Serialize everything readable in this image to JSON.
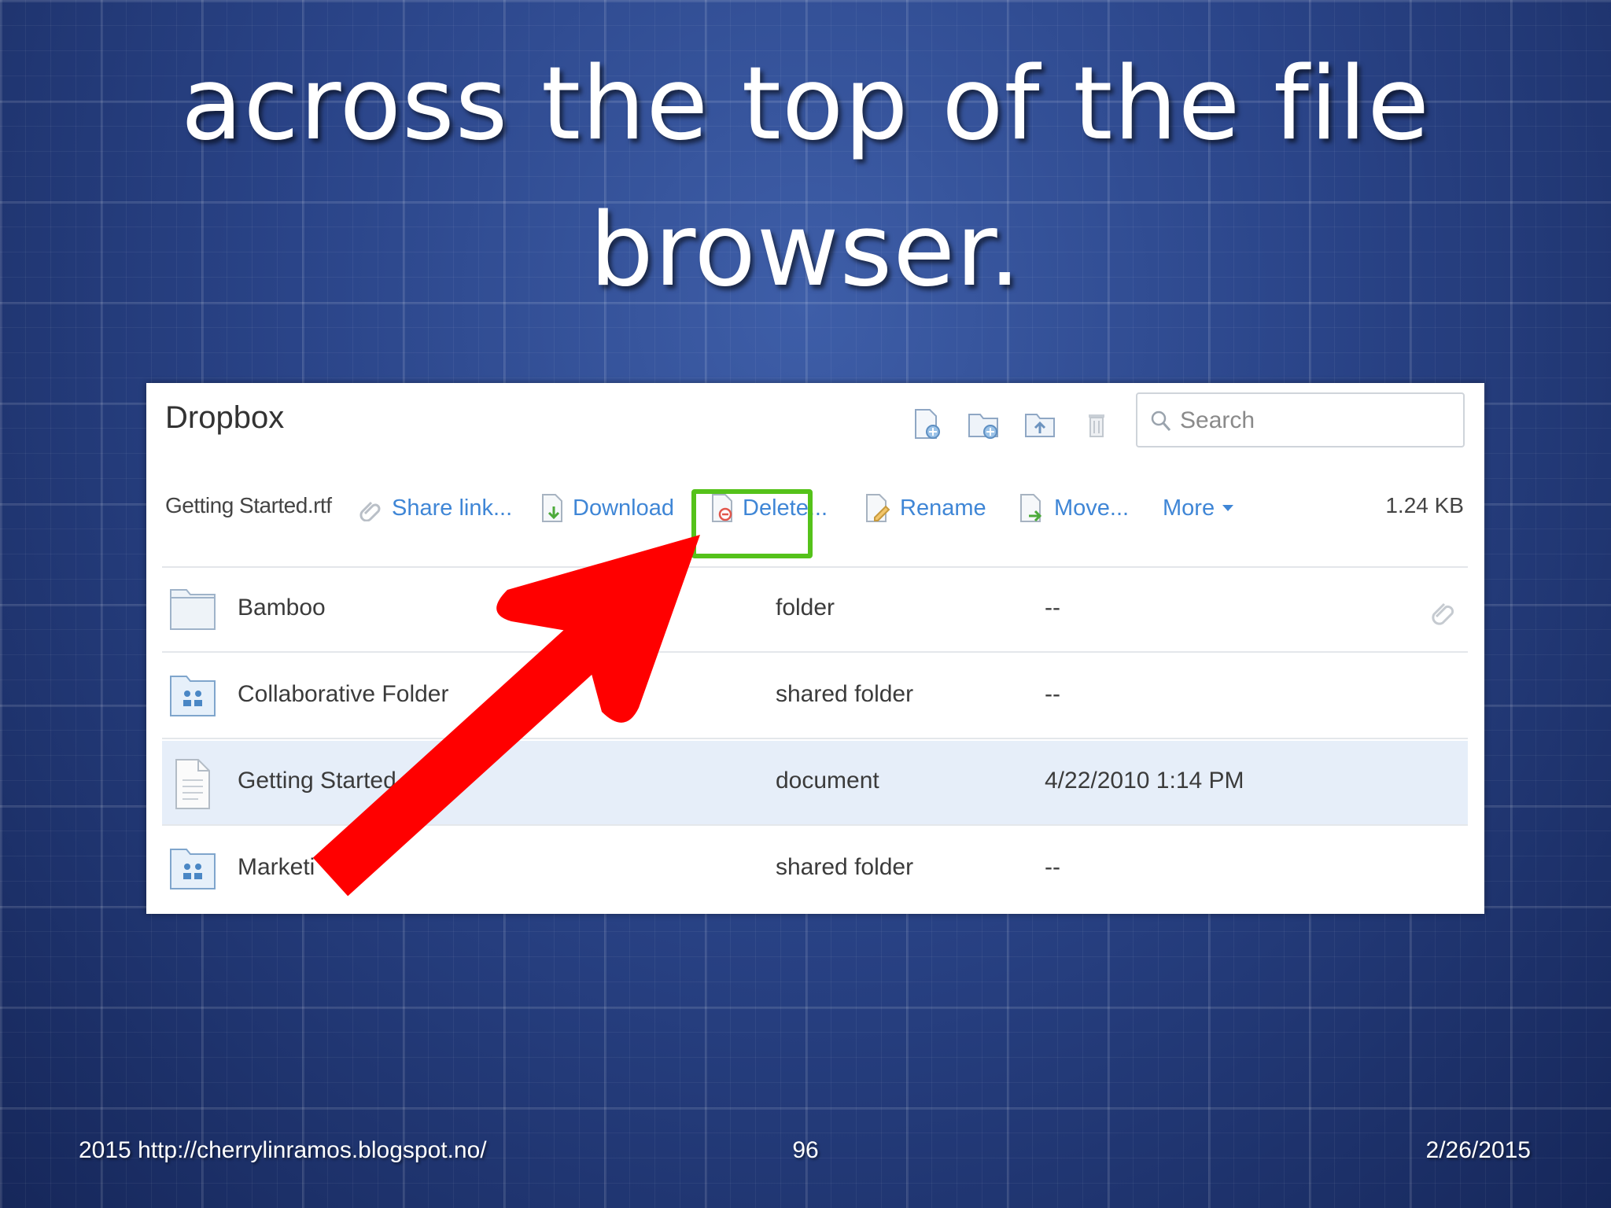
{
  "slide": {
    "title_line1": "across the top of the file",
    "title_line2": "browser.",
    "footer_left": "2015 http://cherrylinramos.blogspot.no/",
    "page_number": "96",
    "footer_date": "2/26/2015"
  },
  "app": {
    "title": "Dropbox",
    "toolbar_icons": [
      "new-file-icon",
      "new-folder-icon",
      "upload-icon",
      "trash-icon"
    ],
    "search": {
      "placeholder": "Search",
      "value": ""
    }
  },
  "action_bar": {
    "selected_file": "Getting Started.rtf",
    "actions": {
      "share": "Share link...",
      "download": "Download",
      "delete": "Delete...",
      "rename": "Rename",
      "move": "Move...",
      "more": "More"
    },
    "file_size": "1.24 KB"
  },
  "files": [
    {
      "name": "Bamboo",
      "type": "folder",
      "modified": "--",
      "icon": "folder-icon"
    },
    {
      "name": "Collaborative Folder",
      "type": "shared folder",
      "modified": "--",
      "icon": "shared-folder-icon"
    },
    {
      "name": "Getting Started.r",
      "type": "document",
      "modified": "4/22/2010 1:14 PM",
      "icon": "document-icon"
    },
    {
      "name": "Marketi",
      "type": "shared folder",
      "modified": "--",
      "icon": "shared-folder-icon"
    }
  ],
  "colors": {
    "link_blue": "#3f86d6",
    "highlight_green": "#55c21a",
    "arrow_red": "#ff0000",
    "selected_row": "#e6eef9"
  }
}
